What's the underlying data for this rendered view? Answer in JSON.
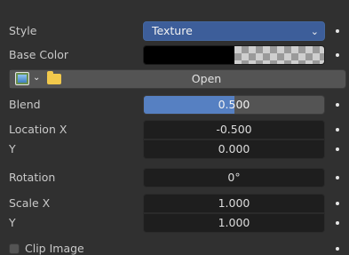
{
  "style": {
    "label": "Style",
    "value": "Texture"
  },
  "base_color": {
    "label": "Base Color",
    "color": "#000000"
  },
  "image": {
    "open_label": "Open"
  },
  "blend": {
    "label": "Blend",
    "value": "0.500",
    "fraction": 0.5
  },
  "location": {
    "x_label": "Location X",
    "x_value": "-0.500",
    "y_label": "Y",
    "y_value": "0.000"
  },
  "rotation": {
    "label": "Rotation",
    "value": "0°"
  },
  "scale": {
    "x_label": "Scale X",
    "x_value": "1.000",
    "y_label": "Y",
    "y_value": "1.000"
  },
  "clip_image": {
    "label": "Clip Image",
    "checked": false
  },
  "colors": {
    "accent": "#5680c2",
    "dropdown": "#3d5e9a",
    "background": "#303030",
    "field": "#1e1e1e"
  }
}
